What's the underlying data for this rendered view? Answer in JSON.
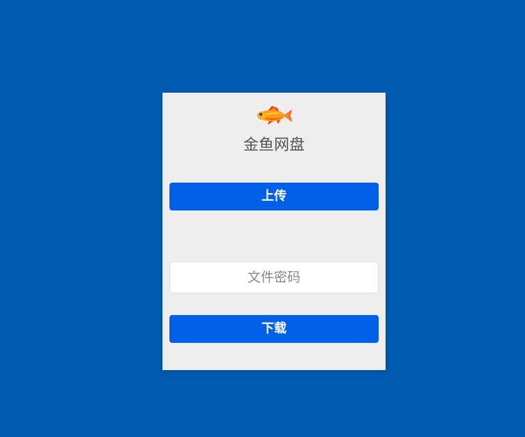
{
  "app": {
    "title": "金鱼网盘",
    "logo_icon": "goldfish-icon"
  },
  "actions": {
    "upload_label": "上传",
    "download_label": "下载"
  },
  "password_field": {
    "placeholder": "文件密码",
    "value": ""
  },
  "colors": {
    "page_background": "#005bb0",
    "card_background": "#eeeeee",
    "button_primary": "#0060e8",
    "button_text": "#ffffff",
    "title_text": "#555555"
  }
}
